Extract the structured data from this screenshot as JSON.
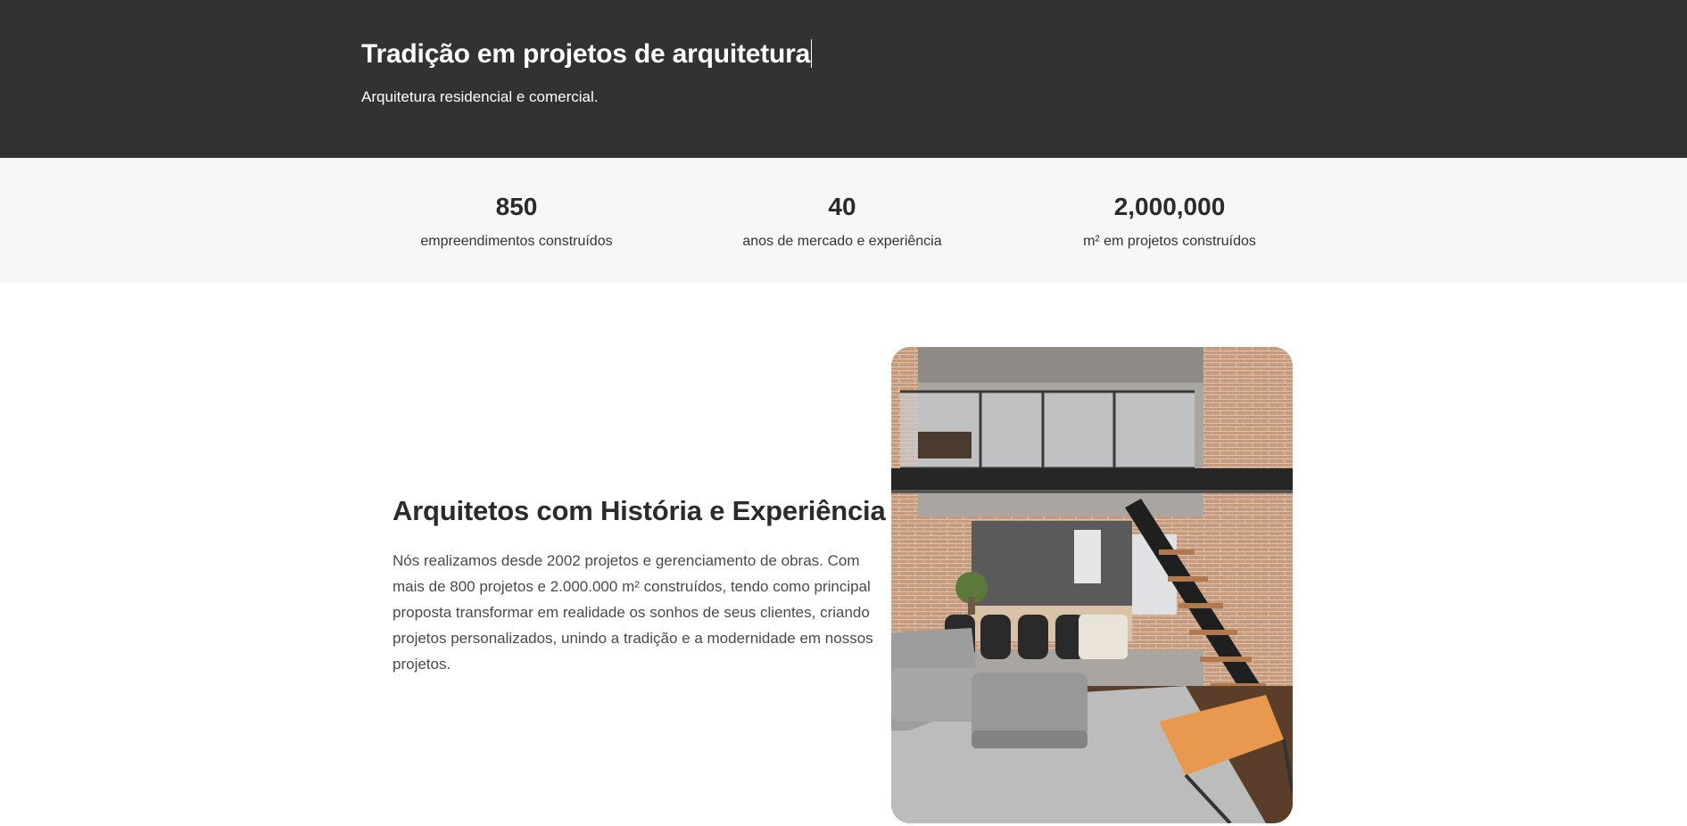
{
  "hero": {
    "title": "Tradição em projetos de arquitetura",
    "subtitle": "Arquitetura residencial e comercial."
  },
  "stats": [
    {
      "value": "850",
      "label": "empreendimentos construídos"
    },
    {
      "value": "40",
      "label": "anos de mercado e experiência"
    },
    {
      "value": "2,000,000",
      "label": "m² em projetos construídos"
    }
  ],
  "about": {
    "title": "Arquitetos com História e Experiência",
    "text": "Nós realizamos desde 2002 projetos e gerenciamento de obras. Com mais de 800 projetos e 2.000.000 m² construídos, tendo como principal proposta transformar em realidade os sonhos de seus clientes, criando projetos personalizados, unindo a tradição e a modernidade em nossos projetos."
  },
  "colors": {
    "hero_bg": "#323232",
    "stats_bg": "#f7f7f7",
    "text_dark": "#2b2b2b"
  }
}
